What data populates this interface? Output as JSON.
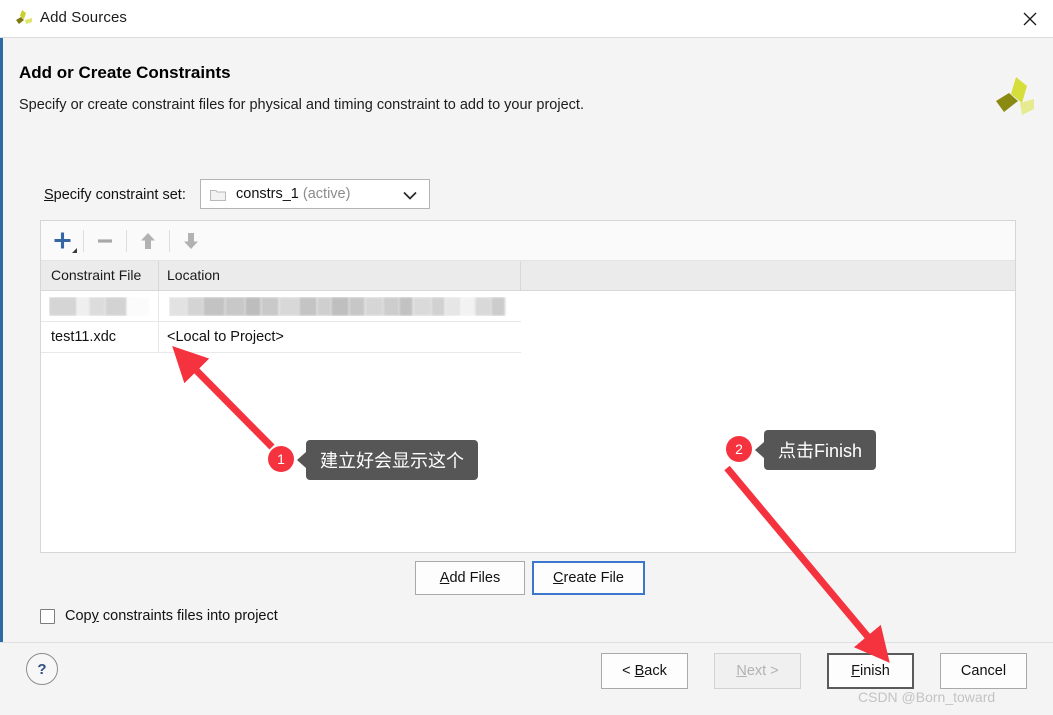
{
  "window": {
    "title": "Add Sources",
    "app_icon": "vivado-logo-icon",
    "close_icon": "close-icon"
  },
  "page": {
    "heading": "Add or Create Constraints",
    "subheading": "Specify or create constraint files for physical and timing constraint to add to your project.",
    "brand_logo": "xilinx-logo-icon"
  },
  "constraint_set": {
    "label_prefix": "S",
    "label_rest": "pecify constraint set:",
    "folder_icon": "folder-icon",
    "value": "constrs_1",
    "value_suffix": "(active)",
    "caret_icon": "chevron-down-icon"
  },
  "toolbar": {
    "add_icon": "plus-icon",
    "remove_icon": "minus-icon",
    "move_up_icon": "arrow-up-icon",
    "move_down_icon": "arrow-down-icon",
    "add_color": "#3465a4"
  },
  "file_table": {
    "columns": [
      "Constraint File",
      "Location"
    ],
    "rows": [
      {
        "file": "",
        "location": "",
        "redacted": true
      },
      {
        "file": "test11.xdc",
        "location": "<Local to Project>",
        "redacted": false
      }
    ]
  },
  "mid_buttons": {
    "add_files": {
      "underlined": "A",
      "rest": "dd Files"
    },
    "create_file": {
      "underlined": "C",
      "rest": "reate File"
    }
  },
  "copy_option": {
    "checked": false,
    "label_a": "Cop",
    "label_u": "y",
    "label_b": " constraints files into project"
  },
  "footer": {
    "help_label": "?",
    "back": {
      "pre": "< ",
      "underlined": "B",
      "rest": "ack"
    },
    "next": {
      "underlined": "N",
      "rest": "ext >"
    },
    "finish": {
      "underlined": "F",
      "rest": "inish"
    },
    "cancel": {
      "underlined": "",
      "rest": "Cancel"
    },
    "next_disabled": true,
    "watermark": "CSDN @Born_toward"
  },
  "annotations": {
    "accent_color": "#f5333f",
    "bubble_color": "#565656",
    "items": [
      {
        "number": "1",
        "text": "建立好会显示这个"
      },
      {
        "number": "2",
        "text": "点击Finish"
      }
    ]
  }
}
